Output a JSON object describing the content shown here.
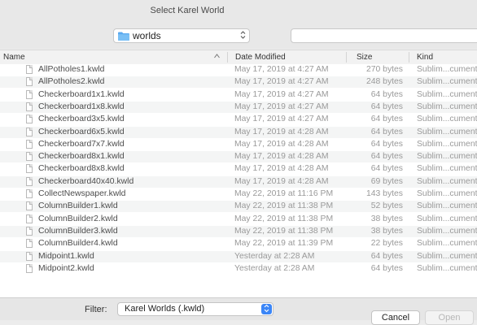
{
  "window": {
    "title": "Select Karel World"
  },
  "toolbar": {
    "location": "worlds",
    "location_icon": "folder-icon",
    "stepper_icon": "⌃⌄",
    "search_icon": "search-icon",
    "search_value": ""
  },
  "columns": {
    "name": "Name",
    "date": "Date Modified",
    "size": "Size",
    "kind": "Kind"
  },
  "files": [
    {
      "name": "AllPotholes1.kwld",
      "date": "May 17, 2019 at 4:27 AM",
      "size": "270 bytes",
      "kind": "Sublim...cument"
    },
    {
      "name": "AllPotholes2.kwld",
      "date": "May 17, 2019 at 4:27 AM",
      "size": "248 bytes",
      "kind": "Sublim...cument"
    },
    {
      "name": "Checkerboard1x1.kwld",
      "date": "May 17, 2019 at 4:27 AM",
      "size": "64 bytes",
      "kind": "Sublim...cument"
    },
    {
      "name": "Checkerboard1x8.kwld",
      "date": "May 17, 2019 at 4:27 AM",
      "size": "64 bytes",
      "kind": "Sublim...cument"
    },
    {
      "name": "Checkerboard3x5.kwld",
      "date": "May 17, 2019 at 4:27 AM",
      "size": "64 bytes",
      "kind": "Sublim...cument"
    },
    {
      "name": "Checkerboard6x5.kwld",
      "date": "May 17, 2019 at 4:28 AM",
      "size": "64 bytes",
      "kind": "Sublim...cument"
    },
    {
      "name": "Checkerboard7x7.kwld",
      "date": "May 17, 2019 at 4:28 AM",
      "size": "64 bytes",
      "kind": "Sublim...cument"
    },
    {
      "name": "Checkerboard8x1.kwld",
      "date": "May 17, 2019 at 4:28 AM",
      "size": "64 bytes",
      "kind": "Sublim...cument"
    },
    {
      "name": "Checkerboard8x8.kwld",
      "date": "May 17, 2019 at 4:28 AM",
      "size": "64 bytes",
      "kind": "Sublim...cument"
    },
    {
      "name": "Checkerboard40x40.kwld",
      "date": "May 17, 2019 at 4:28 AM",
      "size": "69 bytes",
      "kind": "Sublim...cument"
    },
    {
      "name": "CollectNewspaper.kwld",
      "date": "May 22, 2019 at 11:16 PM",
      "size": "143 bytes",
      "kind": "Sublim...cument"
    },
    {
      "name": "ColumnBuilder1.kwld",
      "date": "May 22, 2019 at 11:38 PM",
      "size": "52 bytes",
      "kind": "Sublim...cument"
    },
    {
      "name": "ColumnBuilder2.kwld",
      "date": "May 22, 2019 at 11:38 PM",
      "size": "38 bytes",
      "kind": "Sublim...cument"
    },
    {
      "name": "ColumnBuilder3.kwld",
      "date": "May 22, 2019 at 11:38 PM",
      "size": "38 bytes",
      "kind": "Sublim...cument"
    },
    {
      "name": "ColumnBuilder4.kwld",
      "date": "May 22, 2019 at 11:39 PM",
      "size": "22 bytes",
      "kind": "Sublim...cument"
    },
    {
      "name": "Midpoint1.kwld",
      "date": "Yesterday at 2:28 AM",
      "size": "64 bytes",
      "kind": "Sublim...cument"
    },
    {
      "name": "Midpoint2.kwld",
      "date": "Yesterday at 2:28 AM",
      "size": "64 bytes",
      "kind": "Sublim...cument"
    }
  ],
  "filter": {
    "label": "Filter:",
    "value": "Karel Worlds (.kwld)"
  },
  "buttons": {
    "cancel": "Cancel",
    "open": "Open"
  }
}
